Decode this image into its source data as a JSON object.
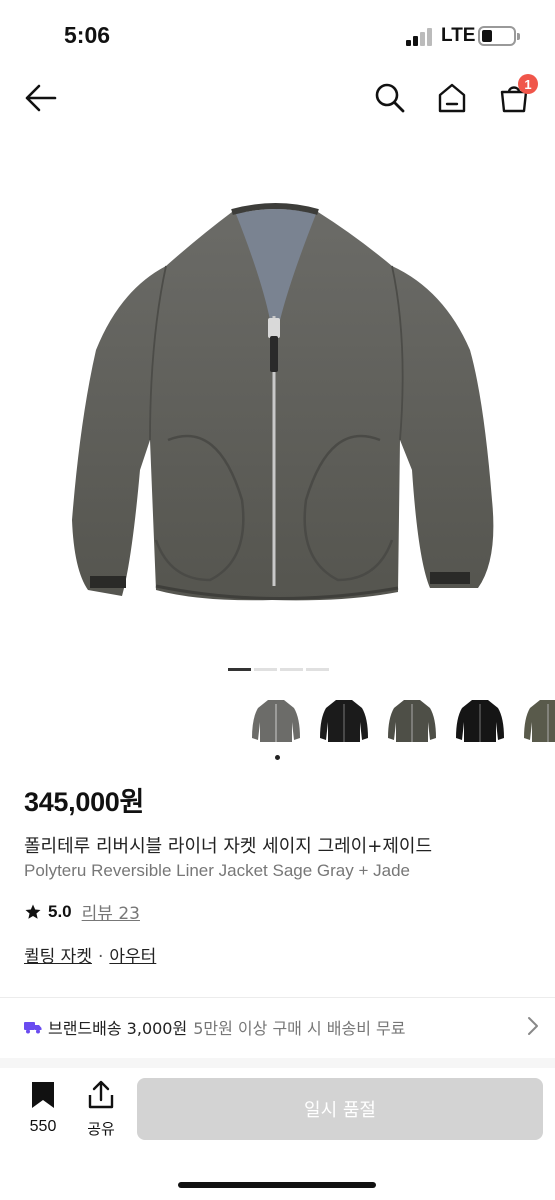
{
  "status": {
    "time": "5:06",
    "network": "LTE"
  },
  "nav": {
    "cart_count": "1"
  },
  "product": {
    "price": "345,000원",
    "name_ko": "폴리테루 리버시블 라이너 자켓 세이지 그레이+제이드",
    "name_en": "Polyteru Reversible Liner Jacket Sage Gray + Jade",
    "rating": "5.0",
    "review_label": "리뷰 23",
    "category_1": "퀼팅 자켓",
    "category_sep": "·",
    "category_2": "아우터"
  },
  "shipping": {
    "brand_label": "브랜드배송 3,000원",
    "note": "5만원 이상 구매 시 배송비 무료"
  },
  "bottom": {
    "like_count": "550",
    "share_label": "공유",
    "cta_label": "일시 품절"
  },
  "thumbnails": [
    "gray",
    "black",
    "olive",
    "black",
    "olive"
  ],
  "colors": {
    "accent_badge": "#f0564a",
    "cta_disabled": "#d3d3d3",
    "shipping_icon": "#6a4cf0"
  }
}
